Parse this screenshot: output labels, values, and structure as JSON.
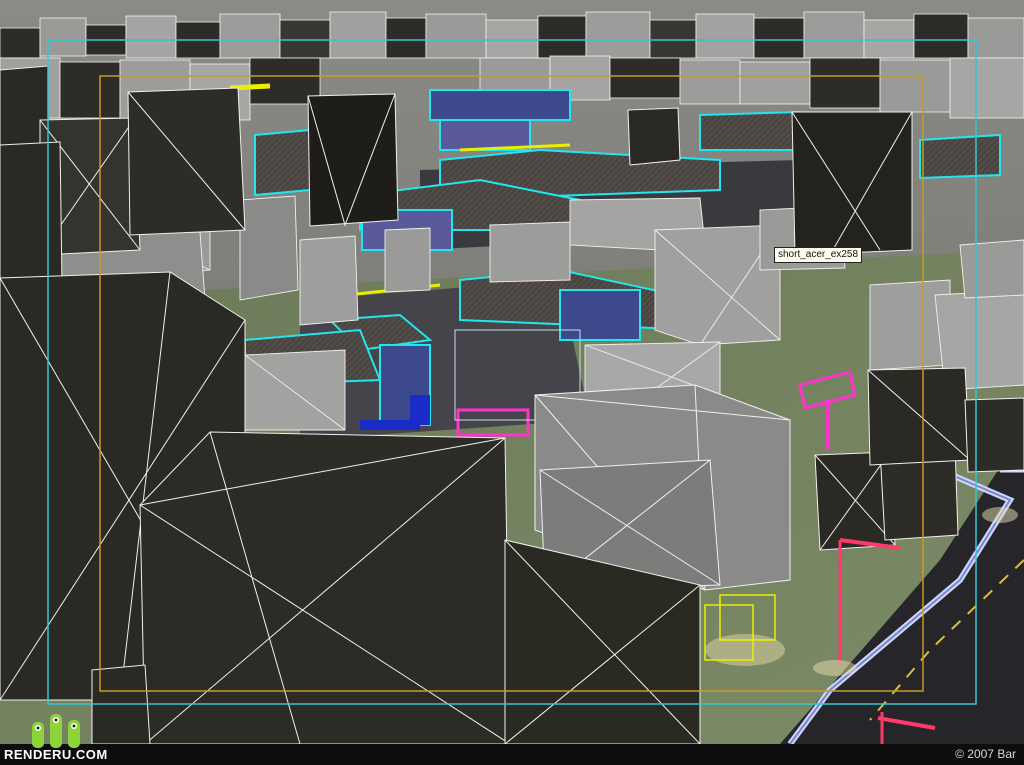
{
  "viewport": {
    "object_tooltip": "short_acer_ex258"
  },
  "footer": {
    "logo_text": "RENDERU.COM",
    "copyright": "© 2007 Bar"
  },
  "colors": {
    "background_gray": "#8a8a84",
    "building_dark": "#2b2924",
    "building_gray": "#8c8c8c",
    "wire_cyan": "#22e6ee",
    "wire_magenta": "#ff33cc",
    "wire_yellow": "#e8f000",
    "ground": "#6f7d5e",
    "road": "#1f1f22",
    "logo_green": "#8dd43a"
  }
}
